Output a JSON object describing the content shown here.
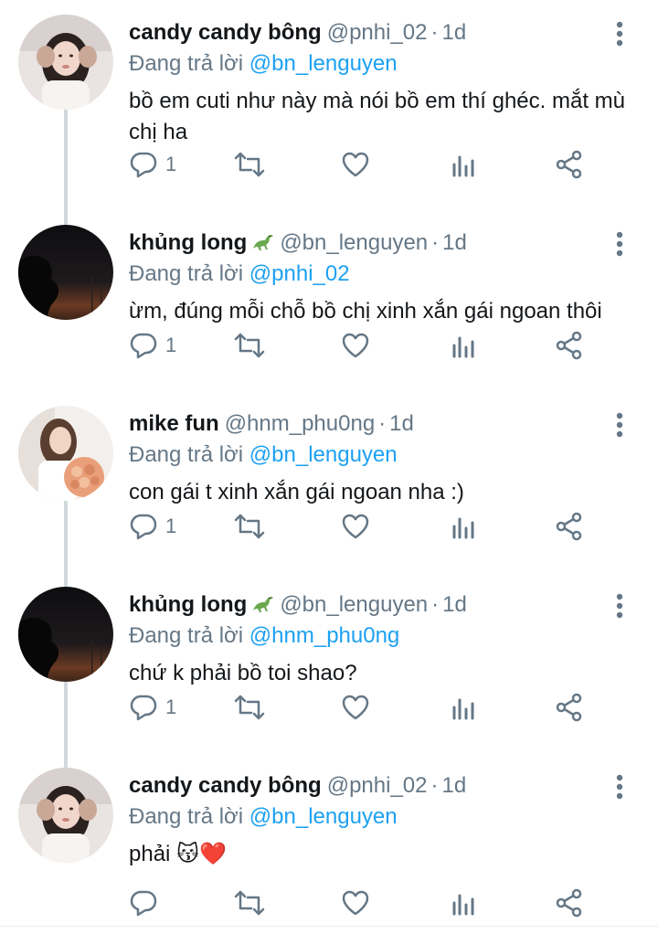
{
  "reply_prefix": "Đang trả lời",
  "tweets": [
    {
      "name": "candy candy bông",
      "handle": "@pnhi_02",
      "time": "1d",
      "reply_to": "@bn_lenguyen",
      "text": "bồ em cuti như này mà nói bồ em thí ghéc. mắt mù chị ha",
      "reply_count": "1",
      "avatar": "girl-photo-avatar",
      "name_emoji": ""
    },
    {
      "name": "khủng long",
      "handle": "@bn_lenguyen",
      "time": "1d",
      "reply_to": "@pnhi_02",
      "text": "ừm, đúng mỗi chỗ bồ chị xinh xắn gái ngoan thôi",
      "reply_count": "1",
      "avatar": "silhouette-sunset-avatar",
      "name_emoji": "dinosaur"
    },
    {
      "name": "mike fun",
      "handle": "@hnm_phu0ng",
      "time": "1d",
      "reply_to": "@bn_lenguyen",
      "text": "con gái t xinh xắn gái ngoan nha :)",
      "reply_count": "1",
      "avatar": "woman-flowers-avatar",
      "name_emoji": ""
    },
    {
      "name": "khủng long",
      "handle": "@bn_lenguyen",
      "time": "1d",
      "reply_to": "@hnm_phu0ng",
      "text": "chứ k phải bồ toi shao?",
      "reply_count": "1",
      "avatar": "silhouette-sunset-avatar",
      "name_emoji": "dinosaur"
    },
    {
      "name": "candy candy bông",
      "handle": "@pnhi_02",
      "time": "1d",
      "reply_to": "@bn_lenguyen",
      "text": "phải 😽❤️",
      "reply_count": "",
      "avatar": "girl-photo-avatar",
      "name_emoji": ""
    }
  ],
  "colors": {
    "text": "#14171a",
    "secondary": "#657786",
    "link": "#1da1f2",
    "thread_line": "#cfd9de"
  }
}
